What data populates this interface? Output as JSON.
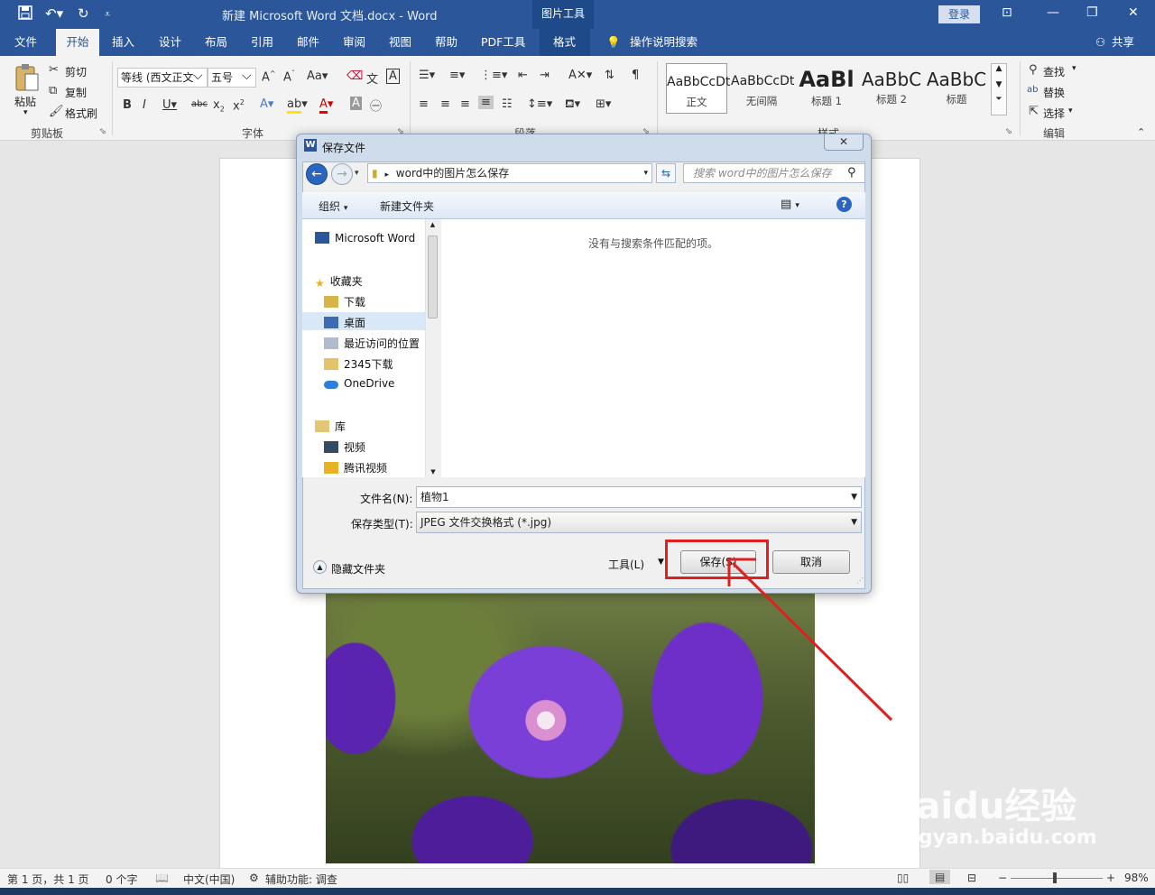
{
  "titlebar": {
    "doc_title": "新建 Microsoft Word 文档.docx  -  Word",
    "context_tools": "图片工具",
    "login": "登录"
  },
  "tabs": [
    "文件",
    "开始",
    "插入",
    "设计",
    "布局",
    "引用",
    "邮件",
    "审阅",
    "视图",
    "帮助",
    "PDF工具",
    "格式"
  ],
  "tell_me": "操作说明搜索",
  "share": "共享",
  "ribbon": {
    "clipboard": {
      "paste": "粘贴",
      "cut": "剪切",
      "copy": "复制",
      "format_painter": "格式刷",
      "group": "剪贴板"
    },
    "font": {
      "font_name": "等线 (西文正文",
      "font_size": "五号",
      "group": "字体"
    },
    "paragraph": {
      "group": "段落"
    },
    "styles": {
      "group": "样式",
      "items": [
        {
          "preview": "AaBbCcDt",
          "name": "正文"
        },
        {
          "preview": "AaBbCcDt",
          "name": "无间隔"
        },
        {
          "preview": "AaBl",
          "name": "标题 1"
        },
        {
          "preview": "AaBbC",
          "name": "标题 2"
        },
        {
          "preview": "AaBbC",
          "name": "标题"
        }
      ]
    },
    "editing": {
      "find": "查找",
      "replace": "替换",
      "select": "选择",
      "group": "编辑"
    }
  },
  "dialog": {
    "title": "保存文件",
    "path": "word中的图片怎么保存",
    "search_placeholder": "搜索 word中的图片怎么保存",
    "organize": "组织",
    "new_folder": "新建文件夹",
    "nav_items": [
      {
        "label": "Microsoft Word",
        "icon": "word-icon"
      },
      {
        "label": "收藏夹",
        "icon": "star-icon"
      },
      {
        "label": "下载",
        "icon": "download-folder-icon"
      },
      {
        "label": "桌面",
        "icon": "desktop-icon"
      },
      {
        "label": "最近访问的位置",
        "icon": "recent-places-icon"
      },
      {
        "label": "2345下载",
        "icon": "folder-icon"
      },
      {
        "label": "OneDrive",
        "icon": "cloud-icon"
      },
      {
        "label": "库",
        "icon": "library-icon"
      },
      {
        "label": "视频",
        "icon": "video-icon"
      },
      {
        "label": "腾讯视频",
        "icon": "folder-icon"
      }
    ],
    "empty_message": "没有与搜索条件匹配的项。",
    "filename_label": "文件名(N):",
    "filename_value": "植物1",
    "filetype_label": "保存类型(T):",
    "filetype_value": "JPEG 文件交换格式 (*.jpg)",
    "hide_folders": "隐藏文件夹",
    "tools": "工具(L)",
    "save": "保存(S)",
    "cancel": "取消"
  },
  "statusbar": {
    "page": "第 1 页，共 1 页",
    "words": "0 个字",
    "language": "中文(中国)",
    "accessibility": "辅助功能: 调查",
    "zoom": "98%"
  },
  "watermark": {
    "brand": "Baidu经验",
    "url": "jingyan.baidu.com"
  },
  "colors": {
    "word_blue": "#2b579a",
    "highlight": "#e02020"
  }
}
